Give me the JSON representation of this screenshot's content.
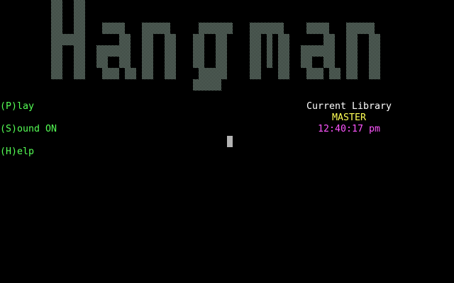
{
  "logo": {
    "text": "Hangman",
    "color": "#8fa89a"
  },
  "menu": {
    "play": "(P)lay",
    "sound": "(S)ound ON",
    "help": "(H)elp",
    "color": "#55ff55"
  },
  "status": {
    "label": "Current Library",
    "library": "MASTER",
    "clock": "12:40:17 pm"
  },
  "colors": {
    "background": "#000000",
    "label": "#ffffff",
    "library": "#ffff55",
    "clock": "#ff55ff",
    "cursor": "#b4b4b4"
  }
}
